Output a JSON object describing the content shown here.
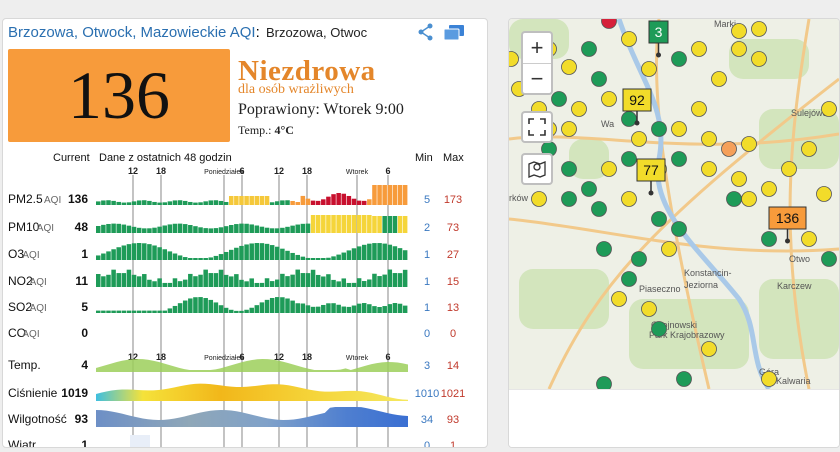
{
  "header": {
    "location": "Brzozowa, Otwock, Mazowieckie",
    "aqi_label": "AQI",
    "city": "Brzozowa, Otwoc"
  },
  "aqi": {
    "value": "136",
    "color": "#f79b3b",
    "status": "Niezdrowa",
    "status_sub": "dla osób wrażliwych",
    "updated": "Poprawiony: Wtorek 9:00",
    "temp_label": "Temp.:",
    "temp_value": "4°C"
  },
  "table": {
    "current_label": "Current",
    "history_label": "Dane z ostatnich 48 godzin",
    "min_label": "Min",
    "max_label": "Max",
    "time_ticks": [
      "12",
      "18",
      "Poniedziałek",
      "6",
      "12",
      "18",
      "Wtorek",
      "6"
    ],
    "rows": [
      {
        "name": "PM2.5",
        "unit": "AQI",
        "current": "136",
        "min": "5",
        "max": "173"
      },
      {
        "name": "PM10",
        "unit": "AQI",
        "current": "48",
        "min": "2",
        "max": "73"
      },
      {
        "name": "O3",
        "unit": "AQI",
        "current": "1",
        "min": "1",
        "max": "27"
      },
      {
        "name": "NO2",
        "unit": "AQI",
        "current": "11",
        "min": "1",
        "max": "15"
      },
      {
        "name": "SO2",
        "unit": "AQI",
        "current": "5",
        "min": "1",
        "max": "13"
      },
      {
        "name": "CO",
        "unit": "AQI",
        "current": "0",
        "min": "0",
        "max": "0"
      },
      {
        "name": "Temp.",
        "unit": "",
        "current": "4",
        "min": "3",
        "max": "14"
      },
      {
        "name": "Ciśnienie",
        "unit": "",
        "current": "1019",
        "min": "1010",
        "max": "1021"
      },
      {
        "name": "Wilgotność",
        "unit": "",
        "current": "93",
        "min": "34",
        "max": "93"
      },
      {
        "name": "Wiatr",
        "unit": "",
        "current": "1",
        "min": "0",
        "max": "1"
      }
    ]
  },
  "map": {
    "zoom_in": "+",
    "zoom_out": "−",
    "markers": [
      "3",
      "92",
      "77",
      "136"
    ],
    "labels": [
      "Marki",
      "Sulejówek",
      "Wa",
      "rków",
      "Otwo",
      "Konstancin-",
      "Jeziorna",
      "Karczew",
      "Piaseczno",
      "Chojnowski",
      "Park Krajobrazowy",
      "Góra",
      "Kalwaria"
    ]
  }
}
